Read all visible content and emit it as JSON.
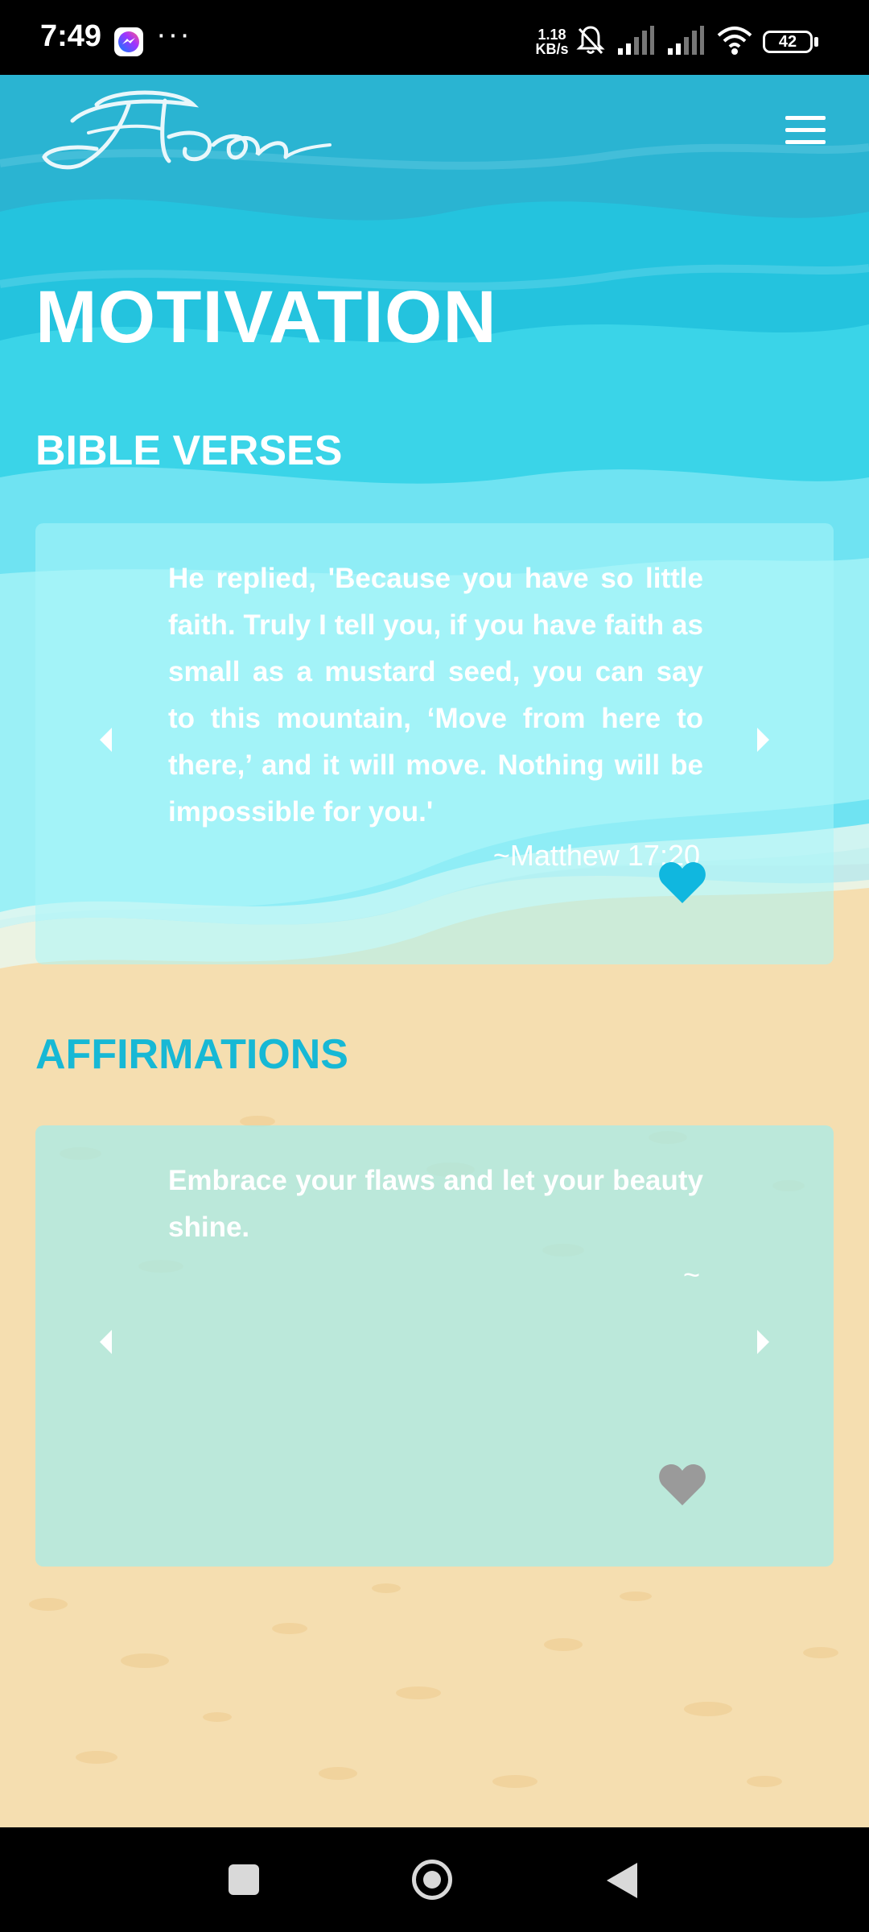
{
  "status_bar": {
    "time": "7:49",
    "dots": "···",
    "net_speed_value": "1.18",
    "net_speed_unit": "KB/s",
    "battery": "42"
  },
  "header": {
    "logo_text": "Elon",
    "menu_icon": "hamburger-menu-icon"
  },
  "page": {
    "title": "MOTIVATION"
  },
  "bible_section": {
    "title": "BIBLE VERSES",
    "verse": "He replied, 'Because you have so little faith. Truly I tell you, if you have faith as small as a mustard seed, you can say to this mountain, ‘Move from here to there,’ and it will move. Nothing will be impossible for you.'",
    "reference": "~Matthew 17:20",
    "favorited": true
  },
  "affirmations_section": {
    "title": "AFFIRMATIONS",
    "text": "Embrace your flaws and let your beauty shine.",
    "reference": "~",
    "favorited": false
  },
  "colors": {
    "accent": "#17b8d5",
    "heart_active": "#10b7df",
    "heart_inactive": "#9a9a9a",
    "sand": "#f5deb0"
  }
}
